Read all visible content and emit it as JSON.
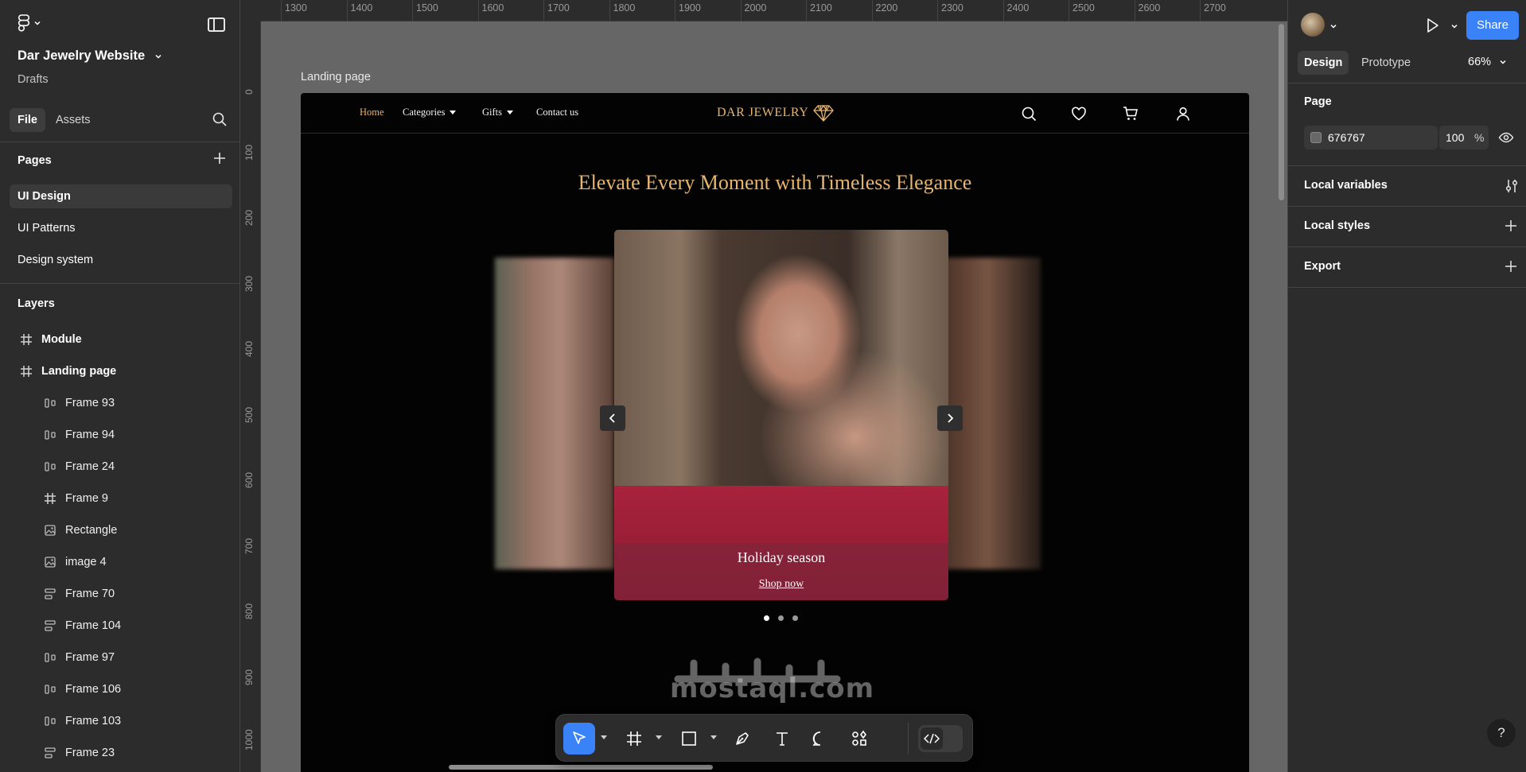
{
  "file": {
    "name": "Dar Jewelry Website",
    "location": "Drafts"
  },
  "left_tabs": [
    {
      "label": "File",
      "active": true
    },
    {
      "label": "Assets",
      "active": false
    }
  ],
  "pages": {
    "title": "Pages",
    "items": [
      {
        "label": "UI Design",
        "active": true
      },
      {
        "label": "UI Patterns",
        "active": false
      },
      {
        "label": "Design system",
        "active": false
      }
    ]
  },
  "layers": {
    "title": "Layers",
    "items": [
      {
        "label": "Module",
        "icon": "frame-icon",
        "level": 0
      },
      {
        "label": "Landing page",
        "icon": "frame-icon",
        "level": 0
      },
      {
        "label": "Frame 93",
        "icon": "auto-layout-horizontal-icon",
        "level": 1
      },
      {
        "label": "Frame 94",
        "icon": "auto-layout-horizontal-icon",
        "level": 1
      },
      {
        "label": "Frame 24",
        "icon": "auto-layout-horizontal-icon",
        "level": 1
      },
      {
        "label": "Frame 9",
        "icon": "frame-icon",
        "level": 1
      },
      {
        "label": "Rectangle",
        "icon": "image-icon",
        "level": 1
      },
      {
        "label": "image 4",
        "icon": "image-icon",
        "level": 1
      },
      {
        "label": "Frame 70",
        "icon": "auto-layout-vertical-icon",
        "level": 1
      },
      {
        "label": "Frame 104",
        "icon": "auto-layout-vertical-icon",
        "level": 1
      },
      {
        "label": "Frame 97",
        "icon": "auto-layout-horizontal-icon",
        "level": 1
      },
      {
        "label": "Frame 106",
        "icon": "auto-layout-horizontal-icon",
        "level": 1
      },
      {
        "label": "Frame 103",
        "icon": "auto-layout-horizontal-icon",
        "level": 1
      },
      {
        "label": "Frame 23",
        "icon": "auto-layout-vertical-icon",
        "level": 1
      }
    ]
  },
  "rulers": {
    "top": [
      "1300",
      "1400",
      "1500",
      "1600",
      "1700",
      "1800",
      "1900",
      "2000",
      "2100",
      "2200",
      "2300",
      "2400",
      "2500",
      "2600",
      "2700"
    ],
    "left": [
      "0",
      "100",
      "200",
      "300",
      "400",
      "500",
      "600",
      "700",
      "800",
      "900",
      "1000"
    ]
  },
  "canvas": {
    "frame_label": "Landing page",
    "site": {
      "nav_links": [
        {
          "label": "Home",
          "active": true,
          "dropdown": false
        },
        {
          "label": "Categories",
          "active": false,
          "dropdown": true
        },
        {
          "label": "Gifts",
          "active": false,
          "dropdown": true
        },
        {
          "label": "Contact us",
          "active": false,
          "dropdown": false
        }
      ],
      "brand": "DAR JEWELRY",
      "nav_icons": [
        "search-icon",
        "heart-icon",
        "cart-icon",
        "user-icon"
      ],
      "hero_title": "Elevate Every Moment with Timeless Elegance",
      "slide_caption": "Holiday season",
      "slide_link": "Shop now",
      "slide_count": 3,
      "active_slide": 1
    },
    "watermark": "mostaql.com"
  },
  "toolbar": {
    "tools": [
      "move-icon",
      "frame-tool-icon",
      "rectangle-tool-icon",
      "pen-tool-icon",
      "text-tool-icon",
      "comment-icon",
      "actions-icon"
    ],
    "active_tool": "move-icon"
  },
  "right_panel": {
    "share_label": "Share",
    "tabs": [
      {
        "label": "Design",
        "active": true
      },
      {
        "label": "Prototype",
        "active": false
      }
    ],
    "zoom": "66%",
    "page_section": {
      "title": "Page",
      "color_hex": "676767",
      "opacity": "100",
      "opacity_unit": "%"
    },
    "sections": [
      "Local variables",
      "Local styles",
      "Export"
    ],
    "help_label": "?"
  },
  "colors": {
    "accent": "#3a82f7",
    "gold": "#e7b56c",
    "canvas_bg": "#666666",
    "panel_bg": "#2c2c2c"
  }
}
